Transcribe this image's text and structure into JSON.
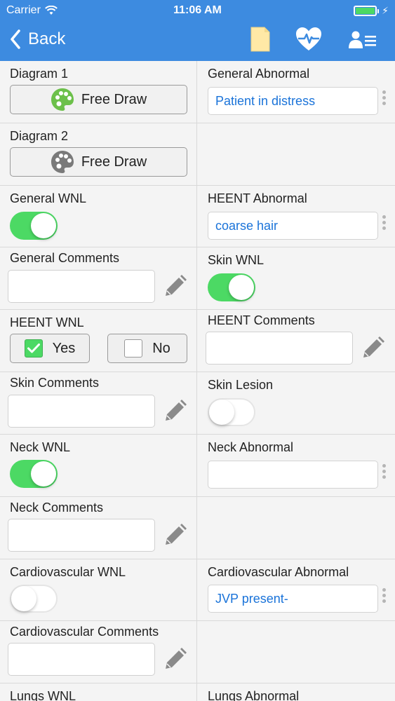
{
  "status_bar": {
    "carrier": "Carrier",
    "time": "11:06 AM"
  },
  "nav": {
    "back_label": "Back"
  },
  "form": {
    "diagram1_label": "Diagram 1",
    "diagram2_label": "Diagram 2",
    "free_draw_label": "Free Draw",
    "general_abnormal_label": "General Abnormal",
    "general_abnormal_value": "Patient in distress",
    "general_wnl_label": "General WNL",
    "heent_abnormal_label": "HEENT Abnormal",
    "heent_abnormal_value": "coarse hair",
    "general_comments_label": "General Comments",
    "skin_wnl_label": "Skin WNL",
    "heent_wnl_label": "HEENT WNL",
    "yes_label": "Yes",
    "no_label": "No",
    "heent_comments_label": "HEENT Comments",
    "skin_comments_label": "Skin Comments",
    "skin_lesion_label": "Skin Lesion",
    "neck_wnl_label": "Neck WNL",
    "neck_abnormal_label": "Neck Abnormal",
    "neck_comments_label": "Neck Comments",
    "cardio_wnl_label": "Cardiovascular WNL",
    "cardio_abnormal_label": "Cardiovascular Abnormal",
    "cardio_abnormal_value": "JVP present-",
    "cardio_comments_label": "Cardiovascular Comments",
    "lungs_wnl_label": "Lungs WNL",
    "lungs_abnormal_label": "Lungs Abnormal"
  },
  "toggles": {
    "general_wnl": true,
    "skin_wnl": true,
    "skin_lesion": false,
    "neck_wnl": true,
    "cardio_wnl": false
  },
  "heent_wnl_selected": "Yes",
  "colors": {
    "header": "#3d8be0",
    "toggle_on": "#4cd964",
    "value_text": "#1a73d9",
    "palette_diagram1": "#6cc04a",
    "palette_diagram2": "#7a7a7a"
  },
  "icons": {
    "back": "chevron-left-icon",
    "notes": "document-icon",
    "vitals": "heart-pulse-icon",
    "patient": "person-list-icon",
    "draw": "palette-icon",
    "edit": "pencil-icon"
  }
}
